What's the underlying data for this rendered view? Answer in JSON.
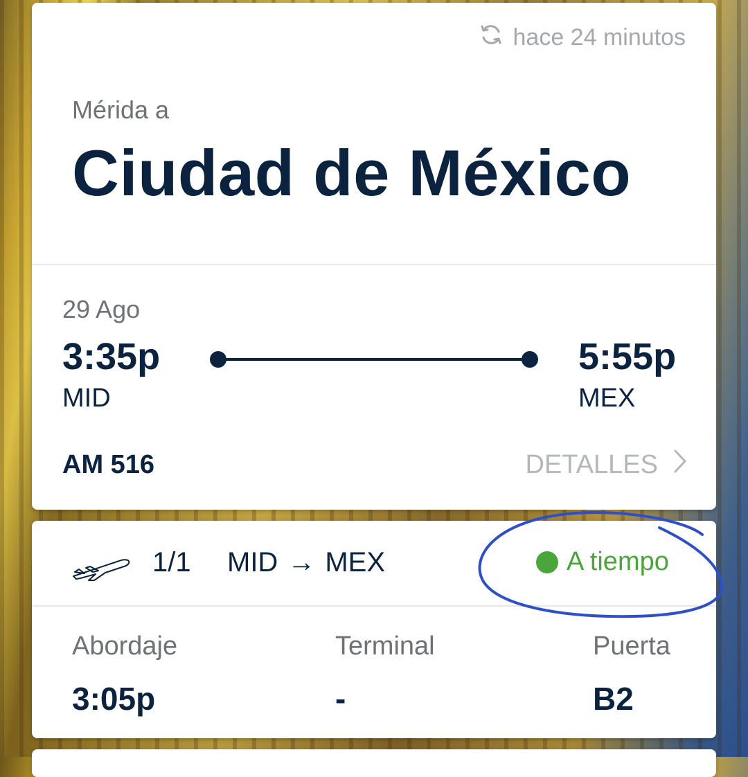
{
  "header": {
    "updated_text": "hace 24 minutos",
    "origin_text": "Mérida a",
    "destination": "Ciudad de México"
  },
  "flight": {
    "date": "29 Ago",
    "departure_time": "3:35p",
    "departure_code": "MID",
    "arrival_time": "5:55p",
    "arrival_code": "MEX",
    "flight_number": "AM 516",
    "details_label": "DETALLES"
  },
  "segment": {
    "count": "1/1",
    "from": "MID",
    "arrow": "→",
    "to": "MEX",
    "status": "A tiempo",
    "status_color": "#4aa53a"
  },
  "boarding": {
    "boarding_label": "Abordaje",
    "boarding_value": "3:05p",
    "terminal_label": "Terminal",
    "terminal_value": "-",
    "gate_label": "Puerta",
    "gate_value": "B2"
  },
  "icons": {
    "refresh": "refresh-icon",
    "chevron": "chevron-right-icon",
    "plane": "airplane-icon"
  },
  "colors": {
    "navy": "#0c2340",
    "muted": "#6e7276",
    "annotation": "#2f4fc9"
  }
}
